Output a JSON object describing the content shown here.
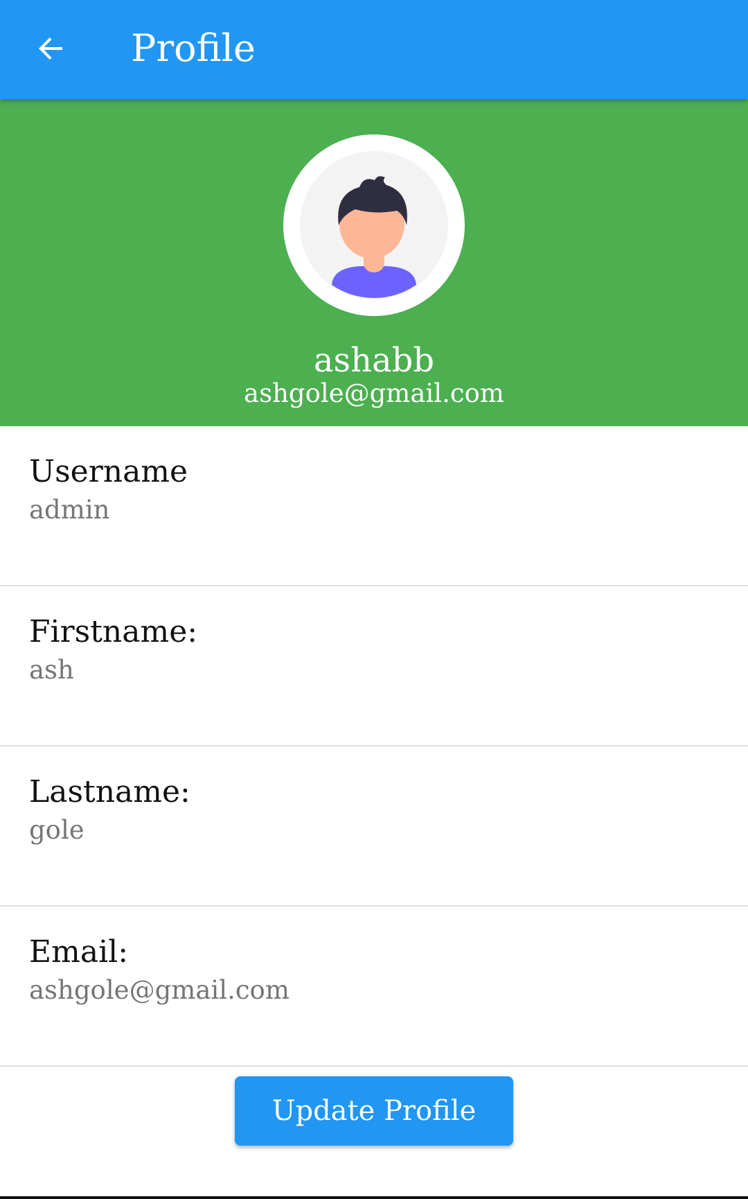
{
  "app_bar": {
    "title": "Profile",
    "back_icon": "arrow-back-icon",
    "color": "#2196F3"
  },
  "header": {
    "color": "#4CAF50",
    "avatar_icon": "user-avatar-icon",
    "display_name": "ashabb",
    "email": "ashgole@gmail.com"
  },
  "fields": [
    {
      "label": "Username",
      "value": "admin"
    },
    {
      "label": "Firstname:",
      "value": "ash"
    },
    {
      "label": "Lastname:",
      "value": "gole"
    },
    {
      "label": "Email:",
      "value": "ashgole@gmail.com"
    }
  ],
  "actions": {
    "update_label": "Update Profile",
    "button_color": "#2196F3"
  }
}
